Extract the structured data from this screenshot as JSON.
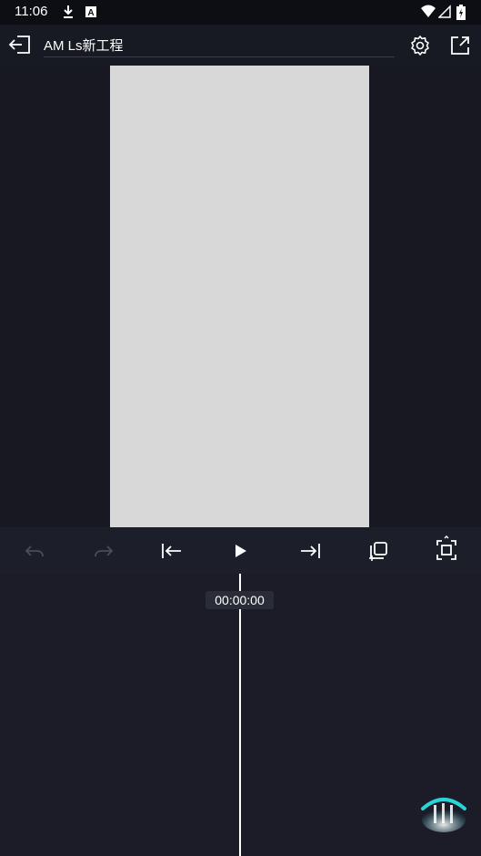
{
  "status_bar": {
    "time": "11:06",
    "icons": [
      "download-icon",
      "a-icon",
      "wifi-icon",
      "signal-icon",
      "battery-icon"
    ]
  },
  "app_bar": {
    "title": "AM Ls新工程",
    "icons": [
      "exit-icon",
      "settings-icon",
      "share-icon"
    ]
  },
  "controls": {
    "icons": [
      "undo-icon",
      "redo-icon",
      "jump-to-start-icon",
      "play-icon",
      "jump-to-end-icon",
      "copy-frame-icon",
      "fullscreen-icon"
    ]
  },
  "timeline": {
    "timecode": "00:00:00"
  },
  "colors": {
    "background": "#1b1c28",
    "canvas": "#d8d8d8",
    "accent": "#2ad4d4"
  }
}
